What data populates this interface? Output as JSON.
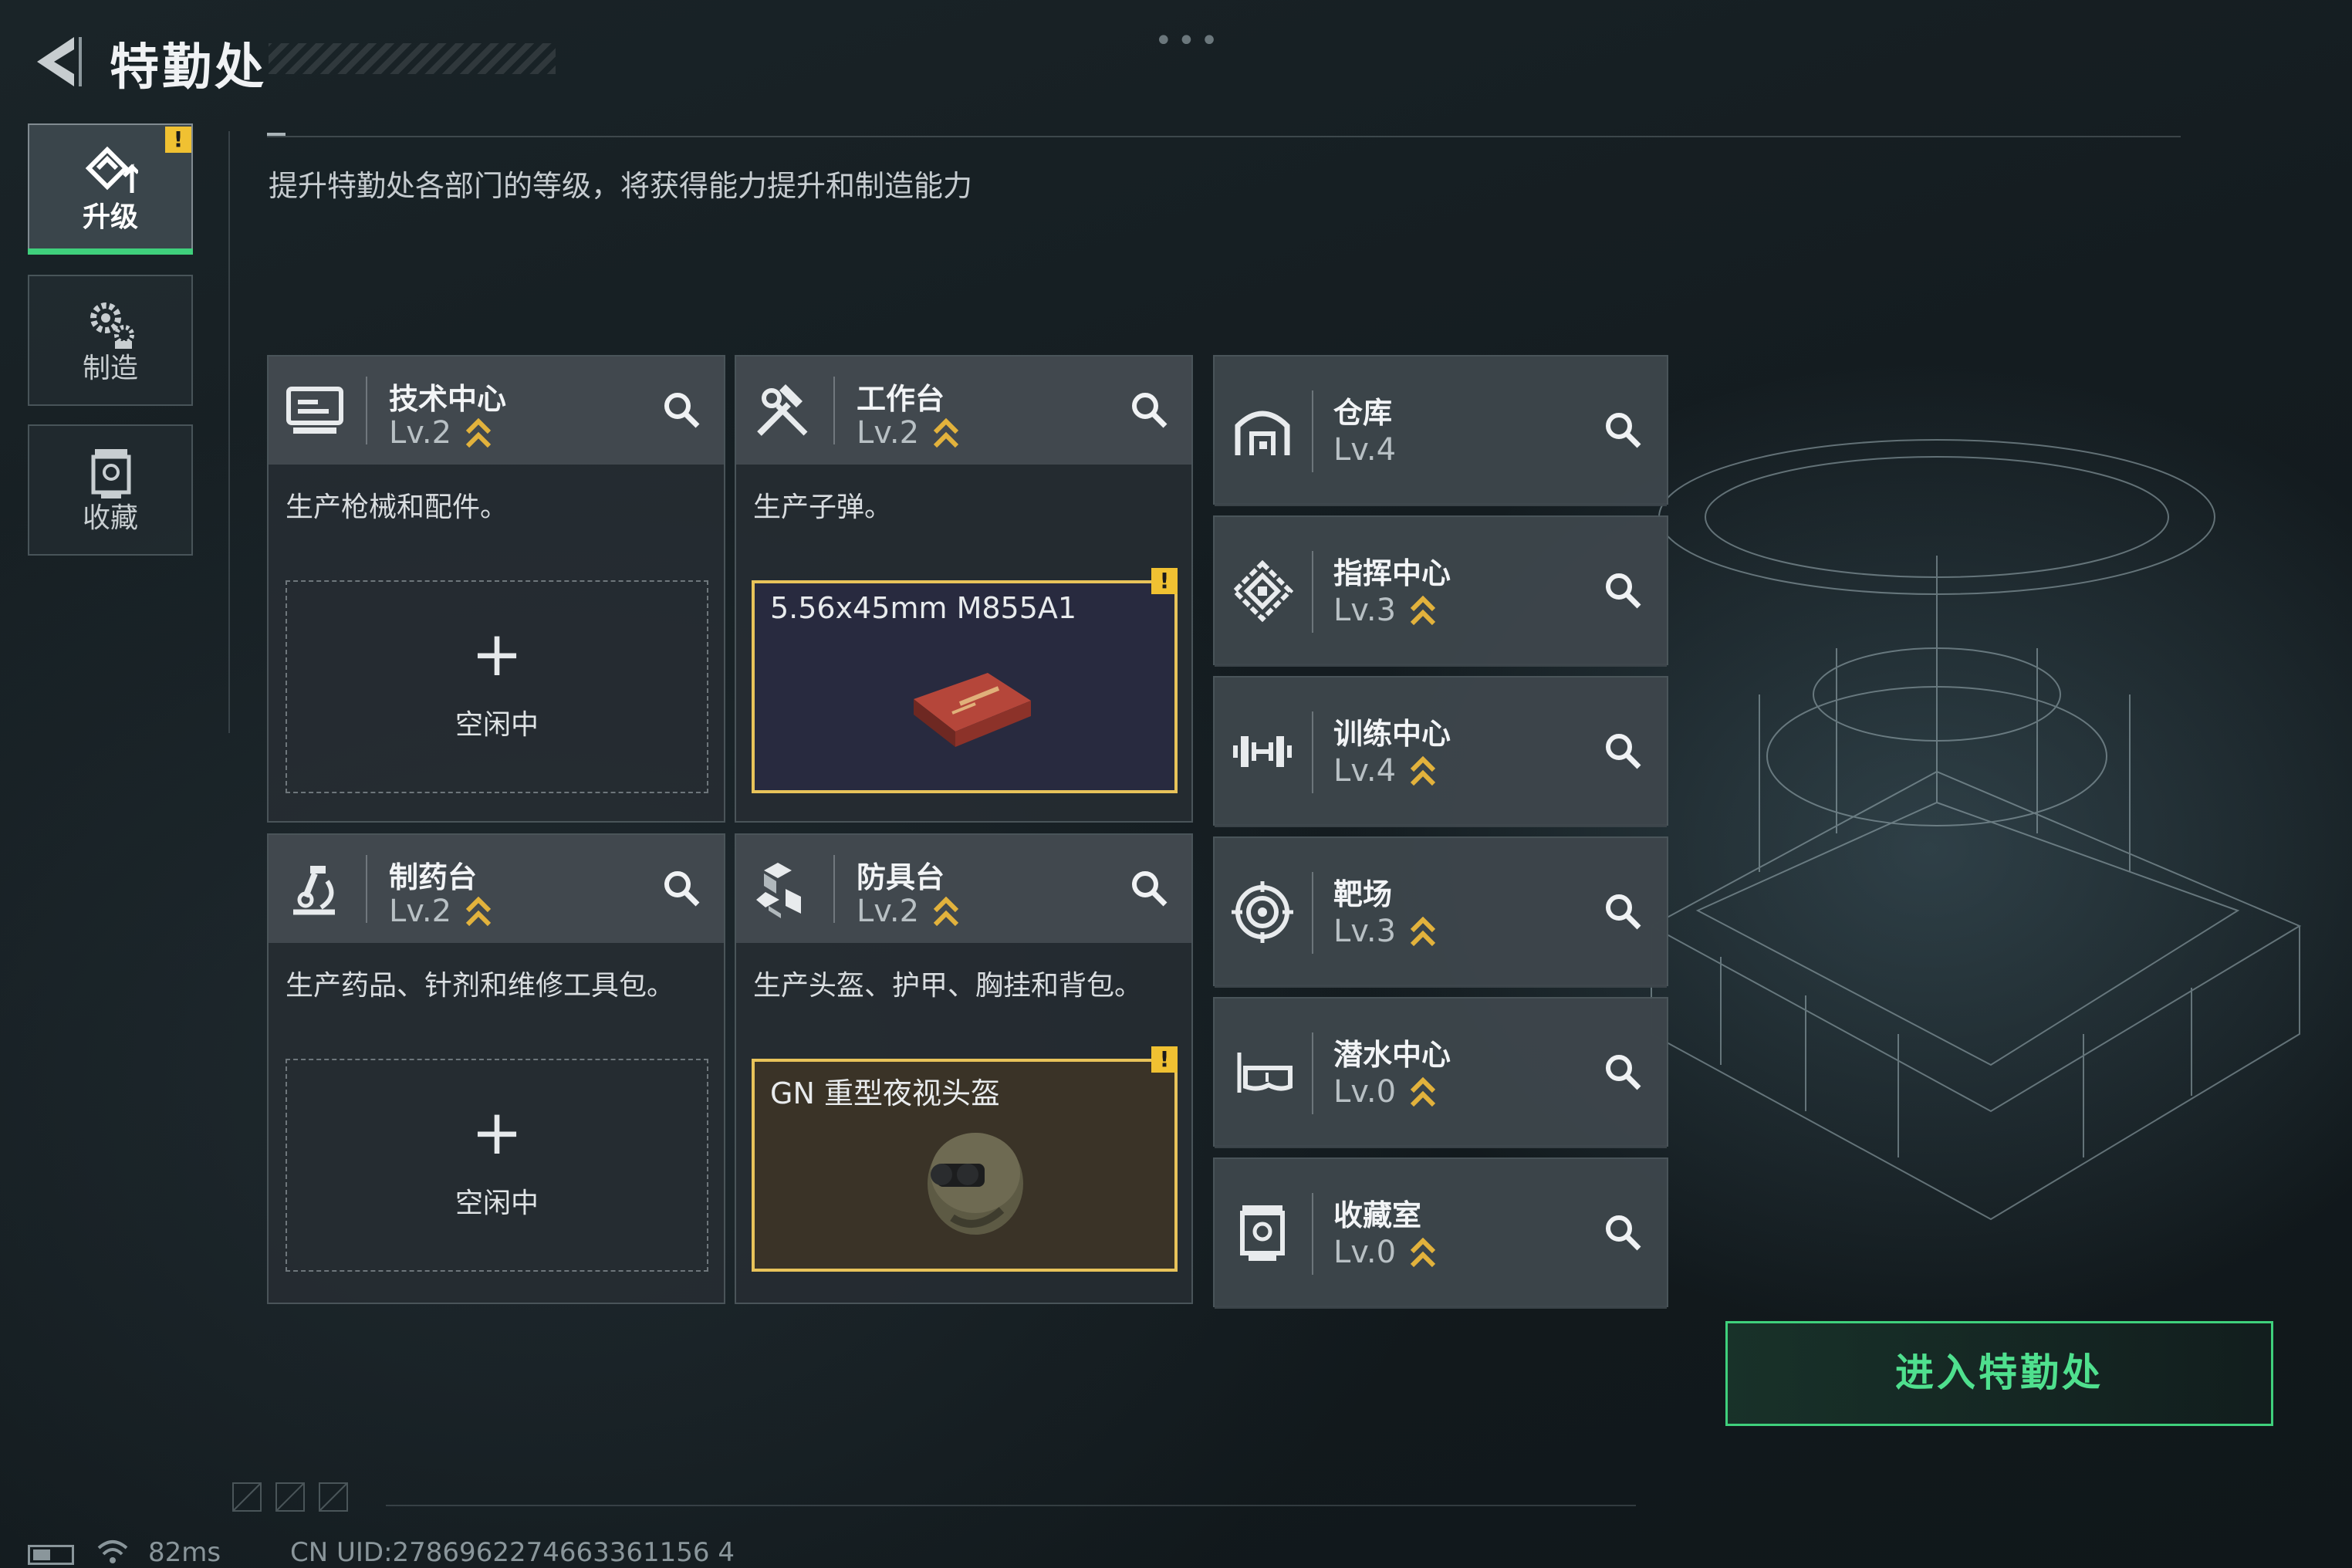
{
  "header": {
    "title": "特勤处",
    "top_dots": "•••"
  },
  "side_tabs": [
    {
      "label": "升级",
      "icon": "upgrade-icon",
      "active": true,
      "warning": "!"
    },
    {
      "label": "制造",
      "icon": "gears-icon",
      "active": false
    },
    {
      "label": "收藏",
      "icon": "collection-icon",
      "active": false
    }
  ],
  "subtitle": "提升特勤处各部门的等级，将获得能力提升和制造能力",
  "departments": [
    {
      "name": "技术中心",
      "level": "Lv.2",
      "description": "生产枪械和配件。",
      "slot": {
        "state": "empty",
        "plus": "+",
        "text": "空闲中"
      }
    },
    {
      "name": "工作台",
      "level": "Lv.2",
      "description": "生产子弹。",
      "slot": {
        "state": "crafting",
        "item": "5.56x45mm M855A1",
        "warning": "!"
      }
    },
    {
      "name": "制药台",
      "level": "Lv.2",
      "description": "生产药品、针剂和维修工具包。",
      "slot": {
        "state": "empty",
        "plus": "+",
        "text": "空闲中"
      }
    },
    {
      "name": "防具台",
      "level": "Lv.2",
      "description": "生产头盔、护甲、胸挂和背包。",
      "slot": {
        "state": "crafting",
        "item": "GN 重型夜视头盔",
        "warning": "!"
      }
    }
  ],
  "buildings": [
    {
      "name": "仓库",
      "level": "Lv.4",
      "icon": "warehouse-icon",
      "upgradeable": false
    },
    {
      "name": "指挥中心",
      "level": "Lv.3",
      "icon": "command-icon",
      "upgradeable": true
    },
    {
      "name": "训练中心",
      "level": "Lv.4",
      "icon": "dumbbell-icon",
      "upgradeable": true
    },
    {
      "name": "靶场",
      "level": "Lv.3",
      "icon": "target-icon",
      "upgradeable": true
    },
    {
      "name": "潜水中心",
      "level": "Lv.0",
      "icon": "diving-mask-icon",
      "upgradeable": true
    },
    {
      "name": "收藏室",
      "level": "Lv.0",
      "icon": "collection-icon",
      "upgradeable": true
    }
  ],
  "enter_button": "进入特勤处",
  "status_bar": {
    "ping": "82ms",
    "uid": "CN UID:2786962274663361156 4"
  },
  "colors": {
    "accent_green": "#3fd07c",
    "warning_yellow": "#f0c132",
    "level_chevron": "#e2b23c",
    "crafting_border": "#e8c35a"
  }
}
